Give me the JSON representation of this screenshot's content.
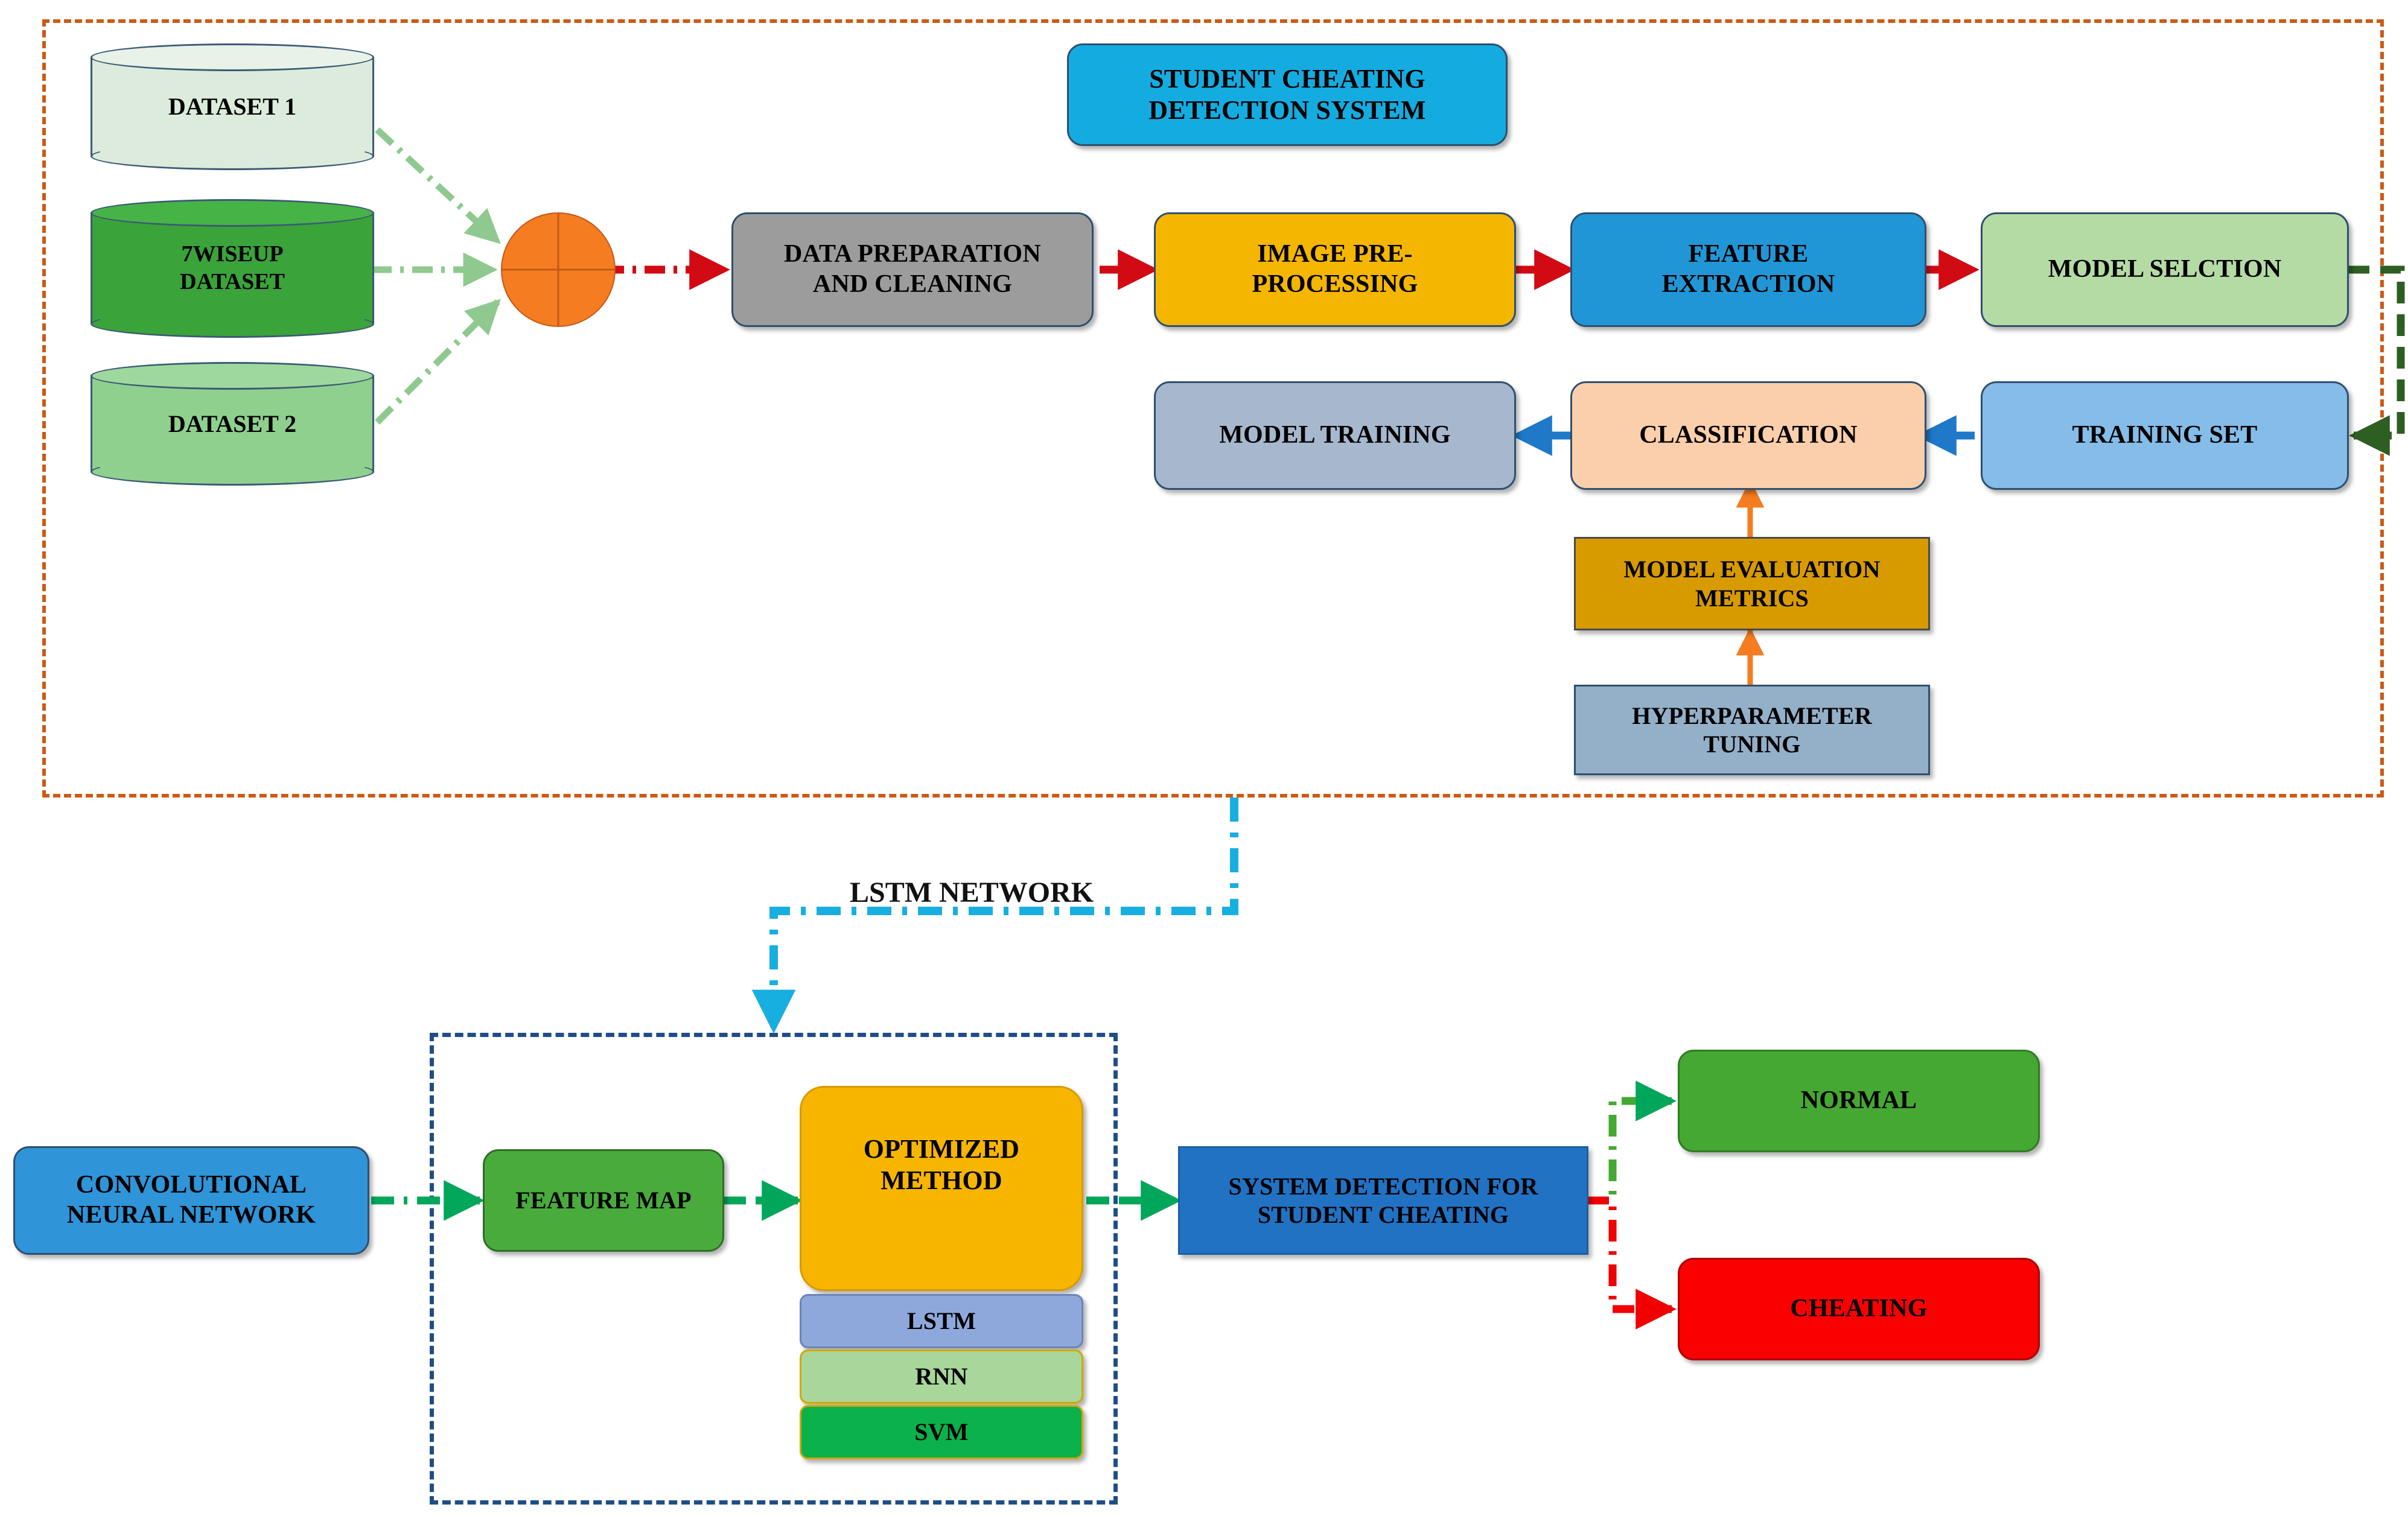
{
  "diagram": {
    "title_box": {
      "label": "STUDENT CHEATING\nDETECTION SYSTEM",
      "color": "#14ace0"
    },
    "free_labels": [
      {
        "name": "lstm-network-label",
        "text": "LSTM NETWORK"
      }
    ],
    "datasets": [
      {
        "name": "dataset-1",
        "label": "DATASET 1",
        "color": "#dcebdc"
      },
      {
        "name": "seven-wiseup-dataset",
        "label": "7WISEUP\nDATASET",
        "color": "#3aa33a"
      },
      {
        "name": "dataset-2",
        "label": "DATASET 2",
        "color": "#8fd08f"
      }
    ],
    "merge_node": {
      "name": "merge-junction",
      "color": "#f57c20"
    },
    "pipeline_top": [
      {
        "name": "data-preparation-and-cleaning",
        "label": "DATA PREPARATION\nAND CLEANING",
        "color": "#9c9c9c"
      },
      {
        "name": "image-pre-processing",
        "label": "IMAGE PRE-\nPROCESSING",
        "color": "#f5b600"
      },
      {
        "name": "feature-extraction",
        "label": "FEATURE\nEXTRACTION",
        "color": "#2196d6"
      },
      {
        "name": "model-selction",
        "label": "MODEL SELCTION",
        "color": "#b5dba5"
      }
    ],
    "pipeline_mid": [
      {
        "name": "model-training",
        "label": "MODEL TRAINING",
        "color": "#a7b8ce"
      },
      {
        "name": "classification",
        "label": "CLASSIFICATION",
        "color": "#fbcfab"
      },
      {
        "name": "training-set",
        "label": "TRAINING SET",
        "color": "#85bce8"
      }
    ],
    "pipeline_support": [
      {
        "name": "model-evaluation-metrics",
        "label": "MODEL EVALUATION\nMETRICS",
        "color": "#d79b00"
      },
      {
        "name": "hyperparameter-tuning",
        "label": "HYPERPARAMETER\nTUNING",
        "color": "#94afc8"
      }
    ],
    "bottom": {
      "cnn": {
        "name": "convolutional-neural-network",
        "label": "CONVOLUTIONAL\nNEURAL NETWORK",
        "color": "#2f94d8"
      },
      "feature_map": {
        "name": "feature-map",
        "label": "FEATURE MAP",
        "color": "#4aab3d"
      },
      "optimized": {
        "name": "optimized-method",
        "label": "OPTIMIZED\nMETHOD",
        "color": "#f7b500"
      },
      "methods": [
        {
          "name": "method-lstm",
          "label": "LSTM",
          "color": "#8fa8dc"
        },
        {
          "name": "method-rnn",
          "label": "RNN",
          "color": "#a9d69a"
        },
        {
          "name": "method-svm",
          "label": "SVM",
          "color": "#0bb14a"
        }
      ],
      "detection": {
        "name": "system-detection-for-student-cheating",
        "label": "SYSTEM DETECTION FOR\nSTUDENT CHEATING",
        "color": "#2272c4"
      },
      "outcomes": [
        {
          "name": "outcome-normal",
          "label": "NORMAL",
          "color": "#45a832"
        },
        {
          "name": "outcome-cheating",
          "label": "CHEATING",
          "color": "#fb0000"
        }
      ]
    },
    "colors": {
      "frame_outer": "#cc5a14",
      "frame_inner": "#1f4e86",
      "flow_red": "#d10a14",
      "flow_blue": "#1f78c8",
      "flow_green_dark": "#2d5e22",
      "flow_green_light": "#8fc98f",
      "flow_orange": "#f57c20",
      "flow_cyan": "#17aee0",
      "flow_green_bright": "#00a65a",
      "flow_red_bright": "#f00000"
    }
  }
}
